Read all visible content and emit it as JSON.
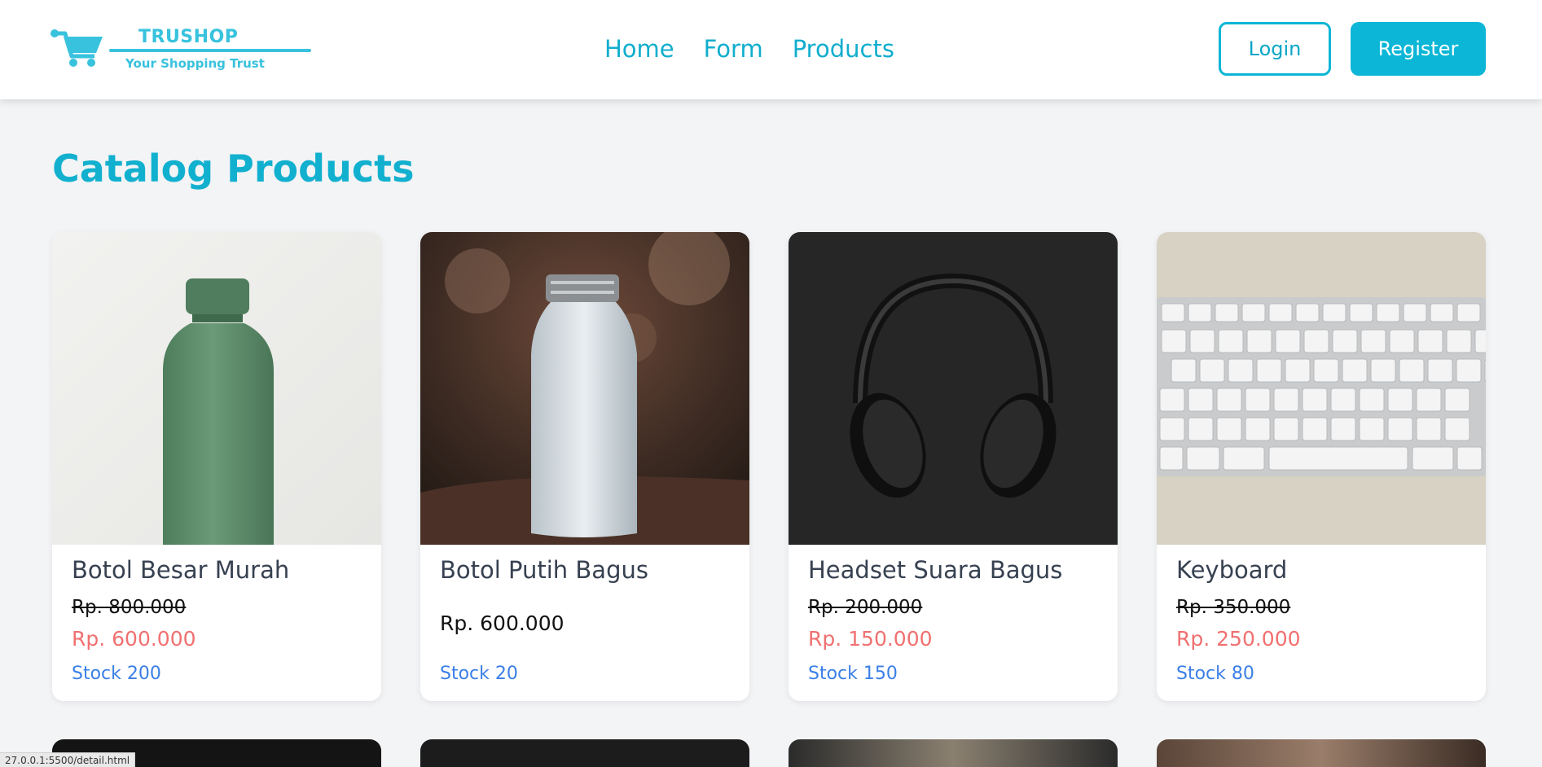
{
  "brand": {
    "name": "TRUSHOP",
    "tagline": "Your Shopping Trust",
    "color": "#38c2dd"
  },
  "nav": {
    "links": [
      {
        "label": "Home"
      },
      {
        "label": "Form"
      },
      {
        "label": "Products"
      }
    ],
    "login_label": "Login",
    "register_label": "Register"
  },
  "page": {
    "title": "Catalog Products"
  },
  "products": [
    {
      "name": "Botol Besar Murah",
      "old_price": "Rp. 800.000",
      "price": "Rp. 600.000",
      "stock": "Stock 200",
      "image": "green-bottle"
    },
    {
      "name": "Botol Putih Bagus",
      "old_price": "",
      "price": "Rp. 600.000",
      "stock": "Stock 20",
      "image": "white-bottle"
    },
    {
      "name": "Headset Suara Bagus",
      "old_price": "Rp. 200.000",
      "price": "Rp. 150.000",
      "stock": "Stock 150",
      "image": "headphones"
    },
    {
      "name": "Keyboard",
      "old_price": "Rp. 350.000",
      "price": "Rp. 250.000",
      "stock": "Stock 80",
      "image": "keyboard"
    }
  ],
  "status_bar": {
    "url": "27.0.0.1:5500/detail.html"
  },
  "colors": {
    "accent": "#0bb6d6",
    "discount_price": "#f07070",
    "stock": "#3b7fe6",
    "background": "#f3f4f6"
  }
}
